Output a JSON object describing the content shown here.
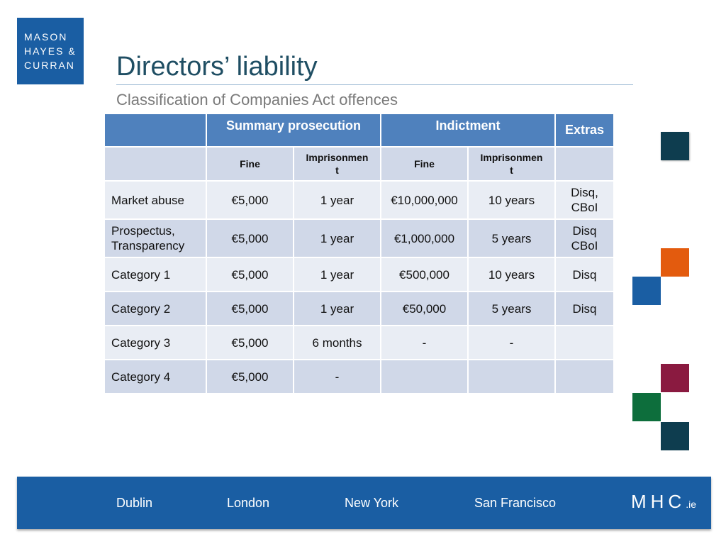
{
  "logo": {
    "lines": [
      "MASON",
      "HAYES &",
      "CURRAN"
    ]
  },
  "title": "Directors’ liability",
  "subtitle": "Classification of Companies Act offences",
  "table": {
    "group_headers": {
      "summary": "Summary prosecution",
      "indictment": "Indictment",
      "extras": "Extras"
    },
    "sub_headers": {
      "fine1": "Fine",
      "imprison1": "Imprisonmen\nt",
      "fine2": "Fine",
      "imprison2": "Imprisonmen\nt"
    },
    "rows": [
      {
        "label": "Market abuse",
        "fine1": "€5,000",
        "imprison1": "1 year",
        "fine2": "€10,000,000",
        "imprison2": "10 years",
        "extras": "Disq,\nCBoI"
      },
      {
        "label": "Prospectus,\nTransparency",
        "fine1": "€5,000",
        "imprison1": "1 year",
        "fine2": "€1,000,000",
        "imprison2": "5 years",
        "extras": "Disq\nCBoI"
      },
      {
        "label": "Category 1",
        "fine1": "€5,000",
        "imprison1": "1 year",
        "fine2": "€500,000",
        "imprison2": "10 years",
        "extras": "Disq"
      },
      {
        "label": "Category 2",
        "fine1": "€5,000",
        "imprison1": "1 year",
        "fine2": "€50,000",
        "imprison2": "5 years",
        "extras": "Disq"
      },
      {
        "label": "Category 3",
        "fine1": "€5,000",
        "imprison1": "6 months",
        "fine2": "-",
        "imprison2": "-",
        "extras": ""
      },
      {
        "label": "Category 4",
        "fine1": "€5,000",
        "imprison1": "-",
        "fine2": "",
        "imprison2": "",
        "extras": ""
      }
    ]
  },
  "footer": {
    "cities": [
      "Dublin",
      "London",
      "New York",
      "San Francisco"
    ],
    "brand": "MHC",
    "brand_suffix": ".ie"
  },
  "colors": {
    "brand_blue": "#1a5ea3",
    "header_blue": "#4f81bd",
    "title_teal": "#1f4e63",
    "deco_dark_teal": "#0e3d4f",
    "deco_orange": "#e35b0e",
    "deco_blue": "#1a5ea3",
    "deco_maroon": "#8a1a40",
    "deco_green": "#0d6e3c"
  }
}
